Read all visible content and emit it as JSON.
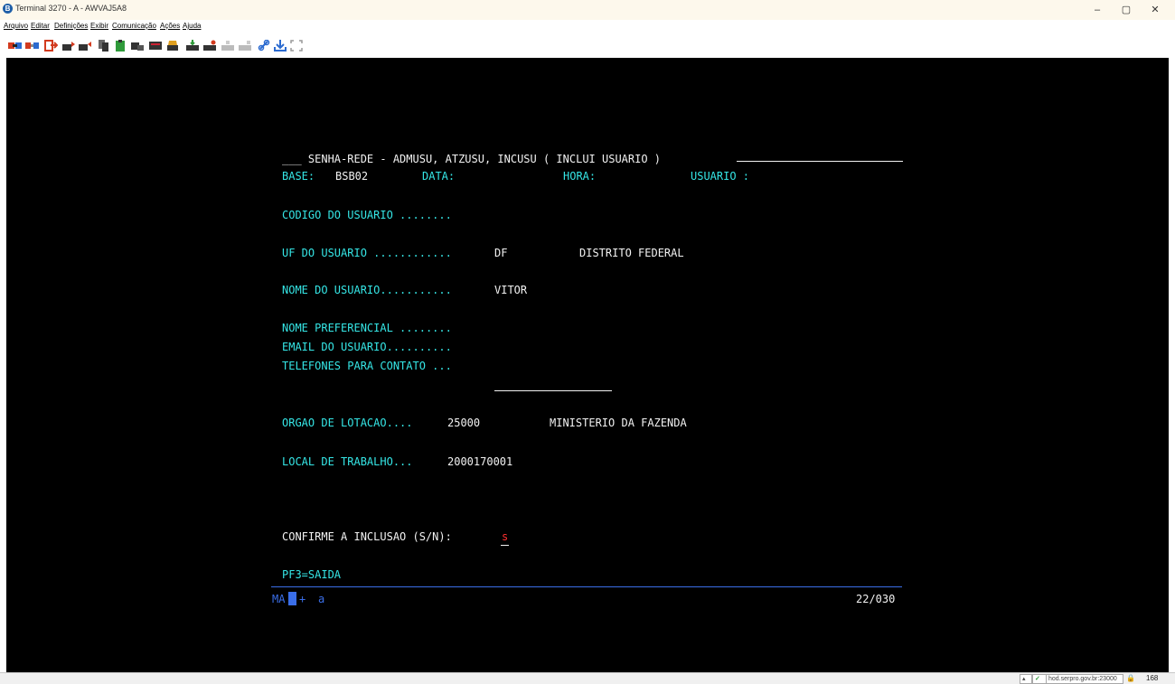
{
  "window": {
    "title": "Terminal 3270 - A - AWVAJ5A8",
    "app_icon_glyph": "B",
    "minimize": "–",
    "maximize": "▢",
    "close": "✕"
  },
  "menu": [
    "Arquivo",
    "Editar",
    "Definições",
    "Exibir",
    "Comunicação",
    "Ações",
    "Ajuda"
  ],
  "toolbar_icons": [
    "connect-icon",
    "disconnect-icon",
    "exit-icon",
    "send-file-icon",
    "receive-file-icon",
    "copy-icon",
    "paste-icon",
    "print-screen-icon",
    "keypad-icon",
    "macro-icon",
    "record-macro-icon",
    "play-macro-icon",
    "stop-macro-icon",
    "pause-macro-icon",
    "link-icon",
    "download-icon",
    "expand-icon"
  ],
  "colors": {
    "terminal_bg": "#000000",
    "field_label": "#35e6e6",
    "field_value": "#f2f2f2",
    "input_cursor": "#ff3030",
    "oia_line": "#3a6ee8"
  },
  "screen": {
    "header_title": "___ SENHA-REDE - ADMUSU, ATZUSU, INCUSU ( INCLUI USUARIO )",
    "base_label": "BASE:",
    "base_value": "BSB02",
    "data_label": "DATA:",
    "hora_label": "HORA:",
    "usuario_label": "USUARIO :",
    "codigo_label": "CODIGO DO USUARIO ........",
    "uf_label": "UF DO USUARIO ............",
    "uf_value": "DF",
    "uf_name": "DISTRITO FEDERAL",
    "nome_label": "NOME DO USUARIO...........",
    "nome_value": "VITOR",
    "preferencial_label": "NOME PREFERENCIAL ........",
    "email_label": "EMAIL DO USUARIO..........",
    "telefones_label": "TELEFONES PARA CONTATO ...",
    "orgao_label": "ORGAO DE LOTACAO....",
    "orgao_code": "25000",
    "orgao_name": "MINISTERIO DA FAZENDA",
    "local_label": "LOCAL DE TRABALHO...",
    "local_code": "2000170001",
    "confirm_label": "CONFIRME A INCLUSAO (S/N):",
    "confirm_value": "s",
    "pf3": "PF3=SAIDA"
  },
  "oia": {
    "mode": "MA",
    "indicator": "+",
    "session": "a",
    "cursor_pos": "22/030"
  },
  "status_bar": {
    "host": "hod.serpro.gov.br:23000",
    "lock_glyph": "🔒",
    "port": "168"
  }
}
